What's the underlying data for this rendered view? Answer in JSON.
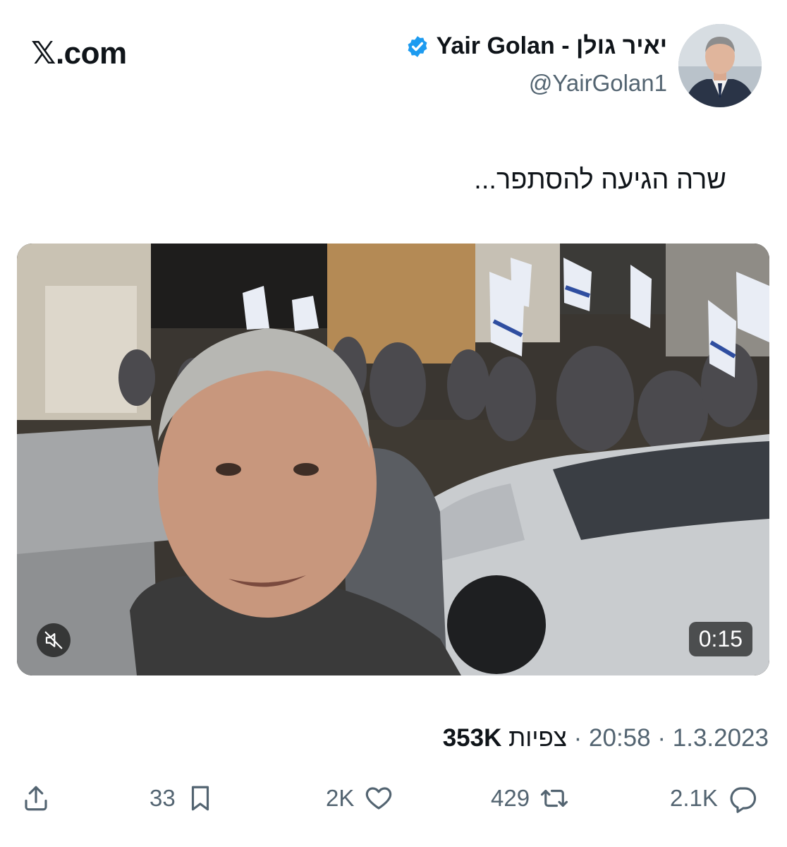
{
  "site": {
    "logo_glyph": "𝕏",
    "logo_suffix": ".com"
  },
  "author": {
    "display_name": "Yair Golan - יאיר גולן",
    "handle": "@YairGolan1",
    "verified": true,
    "verified_color": "#1d9bf0"
  },
  "tweet": {
    "text": "שרה הגיעה להסתפר..."
  },
  "video": {
    "duration": "0:15",
    "muted_icon": "speaker-muted-icon"
  },
  "meta": {
    "date": "1.3.2023",
    "time": "20:58",
    "separator": "·",
    "views_count": "353K",
    "views_label": "צפיות"
  },
  "actions": {
    "share_icon": "share-icon",
    "bookmarks": "33",
    "likes": "2K",
    "retweets": "429",
    "replies": "2.1K"
  }
}
